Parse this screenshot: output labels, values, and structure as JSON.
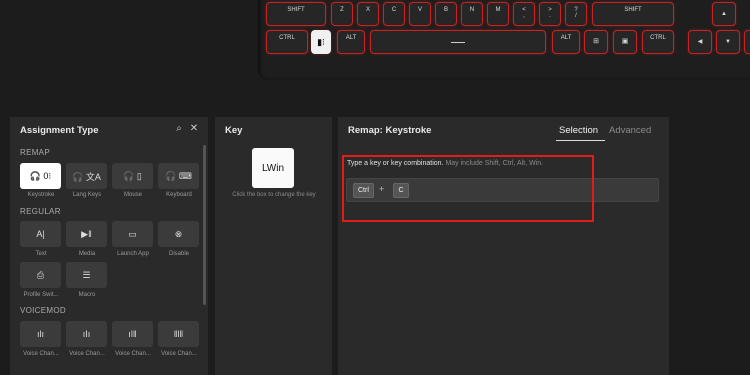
{
  "keyboard": {
    "row1": [
      "SHIFT",
      "Z",
      "X",
      "C",
      "V",
      "B",
      "N",
      "M",
      "<\n,",
      ">\n.",
      "?\n/",
      "SHIFT",
      "▲"
    ],
    "row2": [
      "CTRL",
      "ALT",
      "ALT",
      "CTRL",
      "◀",
      "▼",
      "▶"
    ],
    "win_key_icon": "windows-key-icon",
    "accent_color": "#c62323"
  },
  "assignment_panel": {
    "title": "Assignment Type",
    "sections": {
      "remap": "REMAP",
      "regular": "REGULAR",
      "voicemod": "VOICEMOD"
    },
    "remap_items": [
      {
        "label": "Keystroke",
        "icon": "keystroke-icon",
        "glyph": "🎧 0⁝"
      },
      {
        "label": "Lang Keys",
        "icon": "lang-keys-icon",
        "glyph": "🎧 文A"
      },
      {
        "label": "Mouse",
        "icon": "mouse-icon",
        "glyph": "🎧 ▯"
      },
      {
        "label": "Keyboard",
        "icon": "keyboard-icon",
        "glyph": "🎧 ⌨"
      }
    ],
    "regular_items": [
      {
        "label": "Text",
        "icon": "text-icon",
        "glyph": "A|"
      },
      {
        "label": "Media",
        "icon": "media-icon",
        "glyph": "▶‖"
      },
      {
        "label": "Launch App",
        "icon": "launch-app-icon",
        "glyph": "▭"
      },
      {
        "label": "Disable",
        "icon": "disable-icon",
        "glyph": "⊗"
      },
      {
        "label": "Profile Swit...",
        "icon": "profile-switch-icon",
        "glyph": "⎙"
      },
      {
        "label": "Macro",
        "icon": "macro-icon",
        "glyph": "☰"
      }
    ],
    "voicemod_items": [
      {
        "label": "Voice Chan...",
        "icon": "voice-change-icon",
        "glyph": "ılı"
      },
      {
        "label": "Voice Chan...",
        "icon": "voice-change-icon",
        "glyph": "ıIı"
      },
      {
        "label": "Voice Chan...",
        "icon": "voice-change-icon",
        "glyph": "ıl‖"
      },
      {
        "label": "Voice Chan...",
        "icon": "voice-change-icon",
        "glyph": "‖l‖"
      }
    ]
  },
  "key_panel": {
    "title": "Key",
    "key_value": "LWin",
    "hint": "Click the box to change the key"
  },
  "remap_panel": {
    "title": "Remap: Keystroke",
    "tabs": [
      "Selection",
      "Advanced"
    ],
    "instruction": "Type a key or key combination.",
    "instruction_muted": "May include Shift, Ctrl, Alt, Win.",
    "combo": [
      "Ctrl",
      "C"
    ],
    "plus": "+"
  }
}
